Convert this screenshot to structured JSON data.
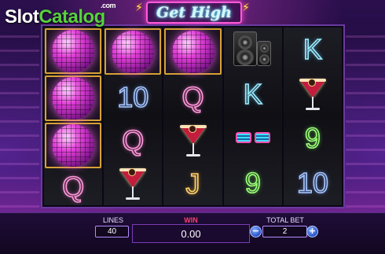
{
  "watermark": {
    "part1": "Slot",
    "part2": "Catalog",
    "suffix": ".com"
  },
  "game": {
    "title": "Get High"
  },
  "reels": [
    [
      "disco-ball",
      "disco-ball",
      "disco-ball",
      "Q"
    ],
    [
      "disco-ball",
      "10",
      "Q",
      "martini"
    ],
    [
      "disco-ball",
      "Q",
      "martini",
      "J"
    ],
    [
      "speakers",
      "K",
      "glasses",
      "9"
    ],
    [
      "K",
      "martini",
      "9",
      "10"
    ]
  ],
  "symbol_labels": {
    "10": "10",
    "Q": "Q",
    "J": "J",
    "K": "K",
    "9": "9"
  },
  "controls": {
    "lines_label": "LINES",
    "lines_value": "40",
    "win_label": "WIN",
    "win_value": "0.00",
    "total_bet_label": "TOTAL BET",
    "total_bet_value": "2",
    "minus": "−",
    "plus": "+"
  },
  "colors": {
    "accent": "#ff5bd8",
    "frame": "#d7a233",
    "win_label": "#ff3d6e",
    "button": "#2350c8"
  }
}
